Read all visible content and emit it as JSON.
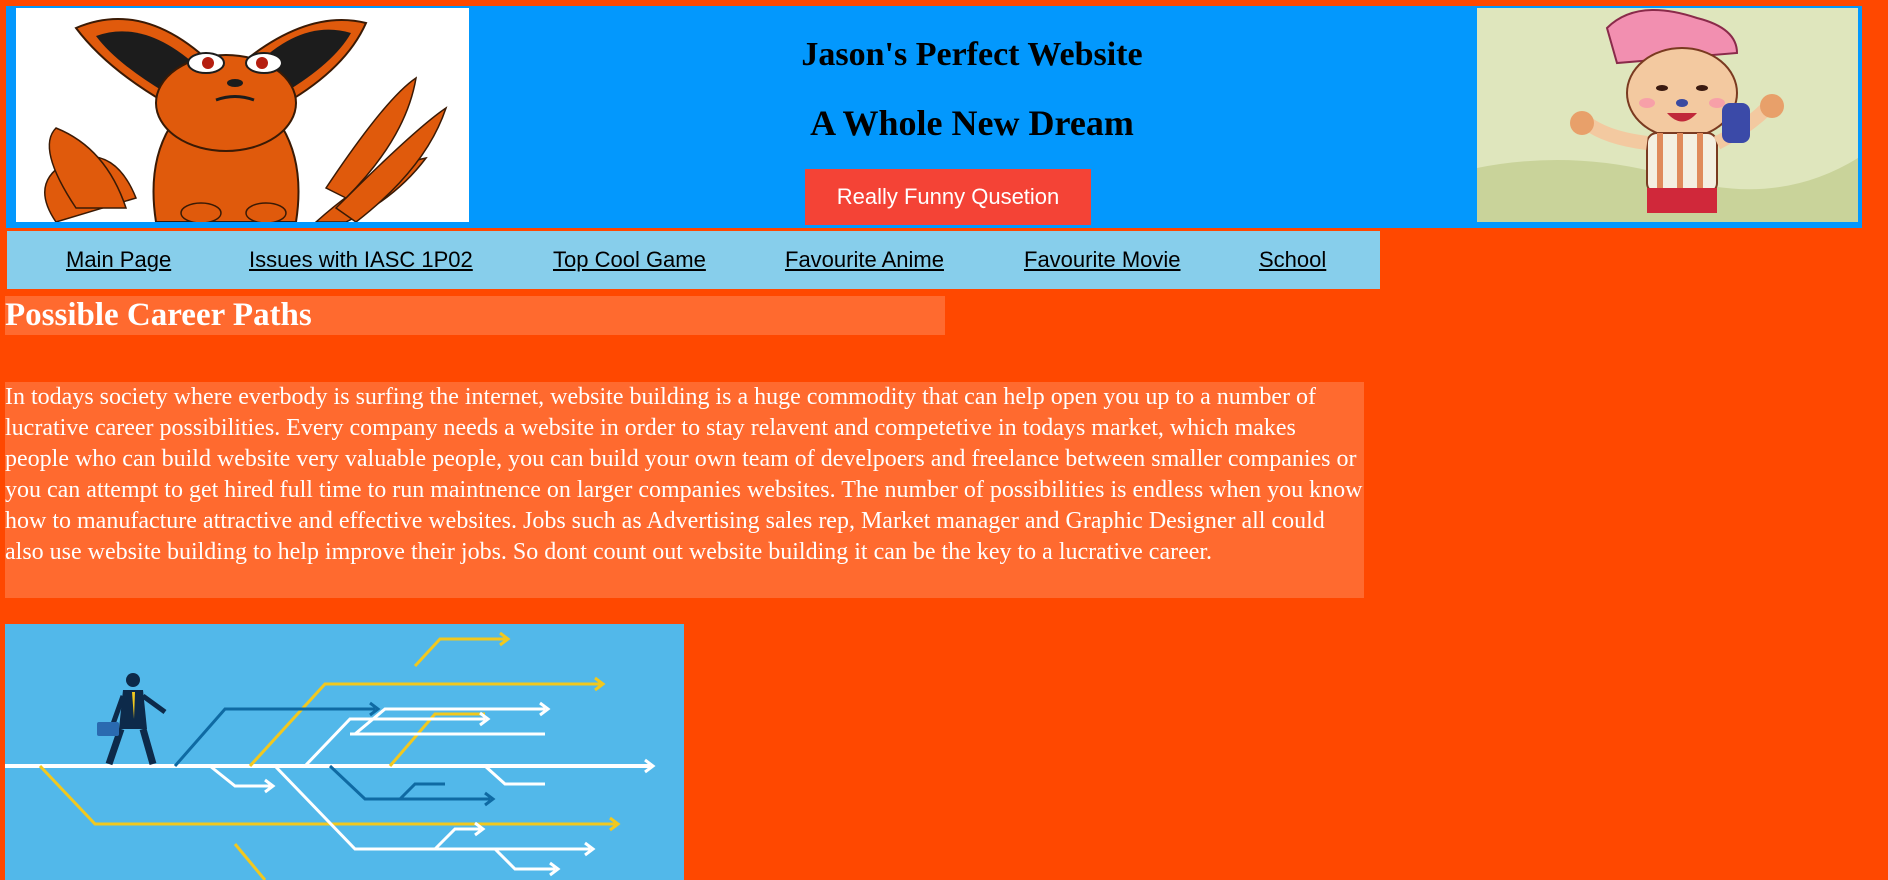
{
  "header": {
    "title": "Jason's Perfect Website",
    "subtitle": "A Whole New Dream",
    "button_label": "Really Funny Qusetion",
    "left_image": "nine-tailed-fox-character",
    "right_image": "reindeer-pirate-character"
  },
  "nav": {
    "items": [
      {
        "label": "Main Page"
      },
      {
        "label": "Issues with IASC 1P02"
      },
      {
        "label": "Top Cool Game"
      },
      {
        "label": "Favourite Anime"
      },
      {
        "label": "Favourite Movie"
      },
      {
        "label": "School"
      }
    ]
  },
  "main": {
    "heading": "Possible Career Paths",
    "paragraph": "In todays society where everbody is surfing the internet, website building is a huge commodity that can help open you up to a number of lucrative career possibilities. Every company needs a website in order to stay relavent and competetive in todays market, which makes people who can build website very valuable people, you can build your own team of develpoers and freelance between smaller companies or you can attempt to get hired full time to run maintnence on larger companies websites. The number of possibilities is endless when you know how to manufacture attractive and effective websites. Jobs such as Advertising sales rep, Market manager and Graphic Designer all could also use website building to help improve their jobs. So dont count out website building it can be the key to a lucrative career.",
    "image": "career-paths-illustration"
  },
  "colors": {
    "page_background": "#ff4800",
    "header_background": "#0398fd",
    "nav_background": "#87ceeb",
    "button_background": "#f44336",
    "content_background": "#ff6a2f",
    "illustration_background": "#52b8ea"
  }
}
